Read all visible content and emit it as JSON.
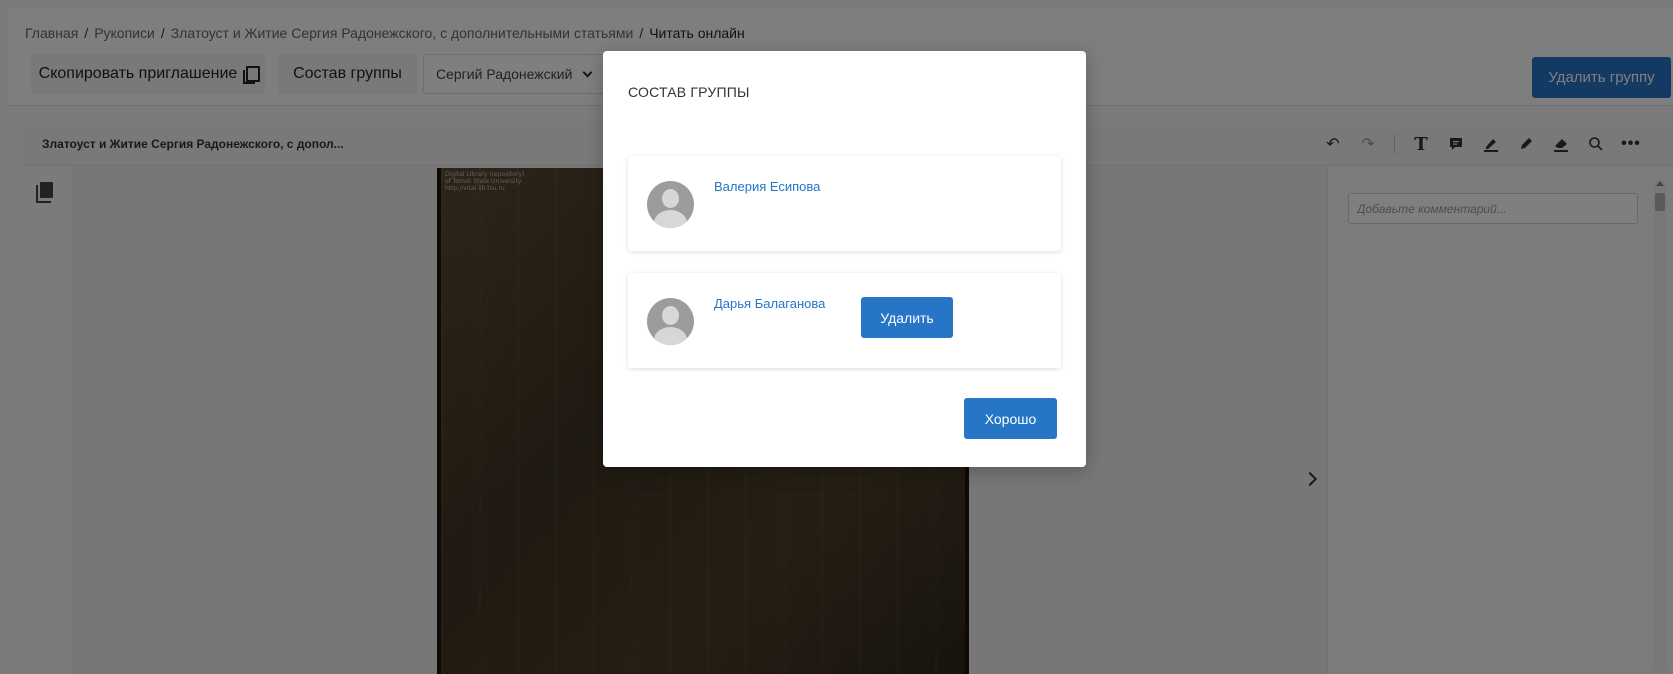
{
  "breadcrumb": {
    "home": "Главная",
    "manuscripts": "Рукописи",
    "manuscript": "Златоуст и Житие Сергия Радонежского, с дополнительными статьями",
    "current": "Читать онлайн",
    "separator": "/"
  },
  "toolbar": {
    "copy_invite_label": "Скопировать приглашение",
    "group_members_label": "Состав группы",
    "selected_user": "Сергий Радонежский",
    "delete_group_label": "Удалить группу"
  },
  "viewer": {
    "doc_title": "Златоуст и Житие Сергия Радонежского, с допол...",
    "tools": [
      "undo-icon",
      "redo-icon",
      "text-icon",
      "comment-icon",
      "highlight-icon",
      "pen-icon",
      "eraser-icon",
      "search-icon",
      "more-icon"
    ],
    "comment_placeholder": "Добавьте комментарий..."
  },
  "modal": {
    "title": "СОСТАВ ГРУППЫ",
    "members": [
      {
        "name": "Валерия Есипова"
      },
      {
        "name": "Дарья Балаганова",
        "delete_label": "Удалить"
      }
    ],
    "ok_label": "Хорошо"
  },
  "colors": {
    "accent": "#2675c6",
    "overlay": "rgba(0,0,0,0.5)"
  }
}
